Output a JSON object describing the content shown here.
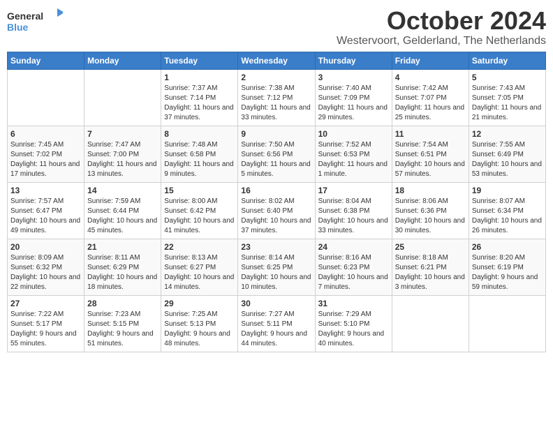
{
  "logo": {
    "line1": "General",
    "line2": "Blue"
  },
  "title": "October 2024",
  "subtitle": "Westervoort, Gelderland, The Netherlands",
  "days_of_week": [
    "Sunday",
    "Monday",
    "Tuesday",
    "Wednesday",
    "Thursday",
    "Friday",
    "Saturday"
  ],
  "weeks": [
    [
      {
        "day": "",
        "detail": ""
      },
      {
        "day": "",
        "detail": ""
      },
      {
        "day": "1",
        "detail": "Sunrise: 7:37 AM\nSunset: 7:14 PM\nDaylight: 11 hours and 37 minutes."
      },
      {
        "day": "2",
        "detail": "Sunrise: 7:38 AM\nSunset: 7:12 PM\nDaylight: 11 hours and 33 minutes."
      },
      {
        "day": "3",
        "detail": "Sunrise: 7:40 AM\nSunset: 7:09 PM\nDaylight: 11 hours and 29 minutes."
      },
      {
        "day": "4",
        "detail": "Sunrise: 7:42 AM\nSunset: 7:07 PM\nDaylight: 11 hours and 25 minutes."
      },
      {
        "day": "5",
        "detail": "Sunrise: 7:43 AM\nSunset: 7:05 PM\nDaylight: 11 hours and 21 minutes."
      }
    ],
    [
      {
        "day": "6",
        "detail": "Sunrise: 7:45 AM\nSunset: 7:02 PM\nDaylight: 11 hours and 17 minutes."
      },
      {
        "day": "7",
        "detail": "Sunrise: 7:47 AM\nSunset: 7:00 PM\nDaylight: 11 hours and 13 minutes."
      },
      {
        "day": "8",
        "detail": "Sunrise: 7:48 AM\nSunset: 6:58 PM\nDaylight: 11 hours and 9 minutes."
      },
      {
        "day": "9",
        "detail": "Sunrise: 7:50 AM\nSunset: 6:56 PM\nDaylight: 11 hours and 5 minutes."
      },
      {
        "day": "10",
        "detail": "Sunrise: 7:52 AM\nSunset: 6:53 PM\nDaylight: 11 hours and 1 minute."
      },
      {
        "day": "11",
        "detail": "Sunrise: 7:54 AM\nSunset: 6:51 PM\nDaylight: 10 hours and 57 minutes."
      },
      {
        "day": "12",
        "detail": "Sunrise: 7:55 AM\nSunset: 6:49 PM\nDaylight: 10 hours and 53 minutes."
      }
    ],
    [
      {
        "day": "13",
        "detail": "Sunrise: 7:57 AM\nSunset: 6:47 PM\nDaylight: 10 hours and 49 minutes."
      },
      {
        "day": "14",
        "detail": "Sunrise: 7:59 AM\nSunset: 6:44 PM\nDaylight: 10 hours and 45 minutes."
      },
      {
        "day": "15",
        "detail": "Sunrise: 8:00 AM\nSunset: 6:42 PM\nDaylight: 10 hours and 41 minutes."
      },
      {
        "day": "16",
        "detail": "Sunrise: 8:02 AM\nSunset: 6:40 PM\nDaylight: 10 hours and 37 minutes."
      },
      {
        "day": "17",
        "detail": "Sunrise: 8:04 AM\nSunset: 6:38 PM\nDaylight: 10 hours and 33 minutes."
      },
      {
        "day": "18",
        "detail": "Sunrise: 8:06 AM\nSunset: 6:36 PM\nDaylight: 10 hours and 30 minutes."
      },
      {
        "day": "19",
        "detail": "Sunrise: 8:07 AM\nSunset: 6:34 PM\nDaylight: 10 hours and 26 minutes."
      }
    ],
    [
      {
        "day": "20",
        "detail": "Sunrise: 8:09 AM\nSunset: 6:32 PM\nDaylight: 10 hours and 22 minutes."
      },
      {
        "day": "21",
        "detail": "Sunrise: 8:11 AM\nSunset: 6:29 PM\nDaylight: 10 hours and 18 minutes."
      },
      {
        "day": "22",
        "detail": "Sunrise: 8:13 AM\nSunset: 6:27 PM\nDaylight: 10 hours and 14 minutes."
      },
      {
        "day": "23",
        "detail": "Sunrise: 8:14 AM\nSunset: 6:25 PM\nDaylight: 10 hours and 10 minutes."
      },
      {
        "day": "24",
        "detail": "Sunrise: 8:16 AM\nSunset: 6:23 PM\nDaylight: 10 hours and 7 minutes."
      },
      {
        "day": "25",
        "detail": "Sunrise: 8:18 AM\nSunset: 6:21 PM\nDaylight: 10 hours and 3 minutes."
      },
      {
        "day": "26",
        "detail": "Sunrise: 8:20 AM\nSunset: 6:19 PM\nDaylight: 9 hours and 59 minutes."
      }
    ],
    [
      {
        "day": "27",
        "detail": "Sunrise: 7:22 AM\nSunset: 5:17 PM\nDaylight: 9 hours and 55 minutes."
      },
      {
        "day": "28",
        "detail": "Sunrise: 7:23 AM\nSunset: 5:15 PM\nDaylight: 9 hours and 51 minutes."
      },
      {
        "day": "29",
        "detail": "Sunrise: 7:25 AM\nSunset: 5:13 PM\nDaylight: 9 hours and 48 minutes."
      },
      {
        "day": "30",
        "detail": "Sunrise: 7:27 AM\nSunset: 5:11 PM\nDaylight: 9 hours and 44 minutes."
      },
      {
        "day": "31",
        "detail": "Sunrise: 7:29 AM\nSunset: 5:10 PM\nDaylight: 9 hours and 40 minutes."
      },
      {
        "day": "",
        "detail": ""
      },
      {
        "day": "",
        "detail": ""
      }
    ]
  ]
}
